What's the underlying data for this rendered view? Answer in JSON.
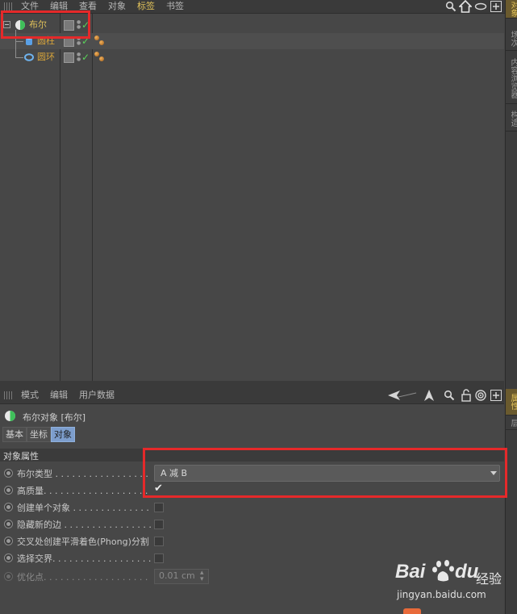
{
  "menubar": {
    "items": [
      "文件",
      "编辑",
      "查看",
      "对象",
      "标签",
      "书签"
    ],
    "active_index": 4
  },
  "right_tabs": [
    "对象",
    "场次",
    "内容浏览器",
    "构造",
    "属性",
    "层"
  ],
  "objects": [
    {
      "name": "布尔",
      "color": "#e0c15a",
      "icon": "boole-icon"
    },
    {
      "name": "圆柱",
      "color": "#d9a53a",
      "icon": "cylinder-icon"
    },
    {
      "name": "圆环",
      "color": "#d9a53a",
      "icon": "torus-icon"
    }
  ],
  "attr": {
    "menu": [
      "模式",
      "编辑",
      "用户数据"
    ],
    "title": "布尔对象 [布尔]",
    "tabs": [
      "基本",
      "坐标",
      "对象"
    ],
    "selected_tab": 2,
    "section": "对象属性",
    "props": [
      {
        "label": "布尔类型 . . . . . . . . . . . . . . . . . . . . . .",
        "type": "dropdown",
        "value": "A 减 B"
      },
      {
        "label": "高质量. . . . . . . . . . . . . . . . . . . . . . . . .",
        "type": "checkbox",
        "checked": true
      },
      {
        "label": "创建单个对象 . . . . . . . . . . . . . . . . .",
        "type": "checkbox",
        "checked": false
      },
      {
        "label": "隐藏新的边 . . . . . . . . . . . . . . . . . . . .",
        "type": "checkbox",
        "checked": false
      },
      {
        "label": "交叉处创建平滑着色(Phong)分割",
        "type": "checkbox",
        "checked": false
      },
      {
        "label": "选择交界. . . . . . . . . . . . . . . . . . . . . . . .",
        "type": "checkbox",
        "checked": false
      },
      {
        "label": "优化点. . . . . . . . . . . . . . . . . . . . . . . . . .",
        "type": "number",
        "value": "0.01 cm",
        "disabled": true
      }
    ]
  },
  "watermark": {
    "brand_left": "Bai",
    "brand_right": "du",
    "product": "经验",
    "url": "jingyan.baidu.com"
  }
}
